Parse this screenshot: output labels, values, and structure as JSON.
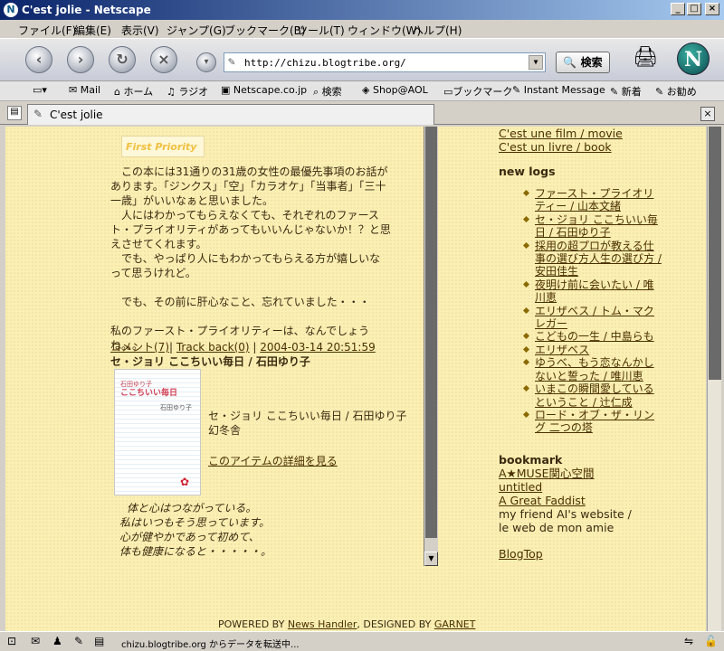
{
  "window": {
    "title": "C'est jolie - Netscape",
    "icon": "netscape-icon"
  },
  "menu": [
    "ファイル(F)",
    "編集(E)",
    "表示(V)",
    "ジャンプ(G)",
    "ブックマーク(B)",
    "ツール(T)",
    "ウィンドウ(W)",
    "ヘルプ(H)"
  ],
  "nav": {
    "url": "http://chizu.blogtribe.org/",
    "search_label": "検索"
  },
  "personal": {
    "items": [
      "Mail",
      "ホーム",
      "ラジオ",
      "Netscape.co.jp",
      "検索",
      "Shop@AOL",
      "ブックマーク",
      "Instant Message",
      "新着",
      "お勧め"
    ]
  },
  "tab": {
    "title": "C'est jolie"
  },
  "page": {
    "banner": "First Priority",
    "entry1": {
      "p1": "この本には31通りの31歳の女性の最優先事項のお話があります。「ジンクス」「空」「カラオケ」「当事者」「三十一歳」がいいなぁと思いました。",
      "p2": "人にはわかってもらえなくても、それぞれのファースト・プライオリティがあってもいいんじゃないか！？と思えさせてくれます。",
      "p3": "でも、やっぱり人にもわかってもらえる方が嬉しいなって思うけれど。",
      "p4": "でも、その前に肝心なこと、忘れていました・・・",
      "p5": "私のファースト・プライオリティーは、なんでしょうね。。。",
      "comment": "コメント(7)",
      "trackback": "Track back(0)",
      "datetime": "2004-03-14 20:51:59"
    },
    "entry2": {
      "title": "セ・ジョリ ここちいい毎日 / 石田ゆり子",
      "cover_small": "石田ゆり子",
      "cover_title": "ここちいい毎日",
      "cover_author": "石田ゆり子",
      "info_title": "セ・ジョリ ここちいい毎日 / 石田ゆり子",
      "publisher": "幻冬舎",
      "detail_link": "このアイテムの詳細を見る",
      "q1": "体と心はつながっている。",
      "q2": "私はいつもそう思っています。",
      "q3": "心が健やかであって初めて、",
      "q4": "体も健康になると・・・・・。"
    },
    "sidebar": {
      "cats": [
        "C'est une film / movie",
        "C'est un livre / book"
      ],
      "newlogs_heading": "new logs",
      "newlogs": [
        "ファースト・プライオリティー / 山本文緒",
        "セ・ジョリ ここちいい毎日 / 石田ゆり子",
        "採用の超プロが教える仕事の選び方人生の選び方 / 安田佳生",
        "夜明け前に会いたい / 唯川恵",
        "エリザベス / トム・マクレガー",
        "こどもの一生 / 中島らも",
        "エリザベス",
        "ゆうべ、もう恋なんかしないと誓った / 唯川恵",
        "いまこの瞬間愛しているということ / 辻仁成",
        "ロード・オブ・ザ・リング 二つの塔"
      ],
      "bookmark_heading": "bookmark",
      "bookmarks": [
        "A★MUSE関心空間",
        "untitled",
        "A Great Faddist"
      ],
      "friend_text": "my friend AI's website / le web de mon amie",
      "blogtop": "BlogTop"
    },
    "footer": {
      "powered": "POWERED BY ",
      "nh": "News Handler",
      "designed": ", DESIGNED BY ",
      "garnet": "GARNET"
    }
  },
  "status": {
    "text": "chizu.blogtribe.org からデータを転送中..."
  }
}
